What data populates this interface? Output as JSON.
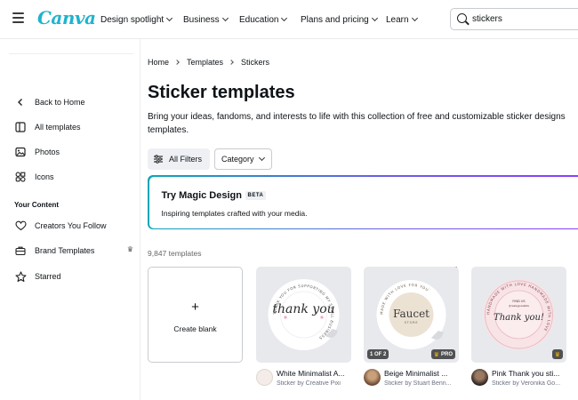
{
  "app": {
    "logo": "Canva"
  },
  "nav": {
    "items": [
      {
        "label": "Design spotlight"
      },
      {
        "label": "Business"
      },
      {
        "label": "Education"
      },
      {
        "label": "Plans and pricing"
      },
      {
        "label": "Learn"
      }
    ]
  },
  "search": {
    "value": "stickers",
    "placeholder": "Search"
  },
  "sidebar": {
    "back": "Back to Home",
    "items": [
      {
        "label": "All templates"
      },
      {
        "label": "Photos"
      },
      {
        "label": "Icons"
      }
    ],
    "section_title": "Your Content",
    "content_items": [
      {
        "label": "Creators You Follow"
      },
      {
        "label": "Brand Templates"
      },
      {
        "label": "Starred"
      }
    ]
  },
  "breadcrumb": [
    "Home",
    "Templates",
    "Stickers"
  ],
  "page": {
    "title": "Sticker templates",
    "description": "Bring your ideas, fandoms, and interests to life with this collection of free and customizable sticker designs templates."
  },
  "filters": {
    "all_filters": "All Filters",
    "category": "Category"
  },
  "magic": {
    "title": "Try Magic Design",
    "badge": "BETA",
    "subtitle": "Inspiring templates crafted with your media."
  },
  "results": {
    "count": "9,847 templates",
    "create_blank": "Create blank"
  },
  "templates": [
    {
      "sticker_text": "thank you",
      "ring_text": "THANK YOU FOR SUPPORTING MY SMALL BUSINESS",
      "title": "White Minimalist A...",
      "subtitle": "Sticker by Creative Pixi"
    },
    {
      "sticker_text": "Faucet",
      "sticker_sub": "STORE",
      "ring_text": "MADE WITH LOVE FOR YOU",
      "page_badge": "1 OF 2",
      "pro_badge": "PRO",
      "title": "Beige Minimalist ...",
      "subtitle": "Sticker by Stuart Benn..."
    },
    {
      "sticker_text": "Thank you!",
      "sticker_top": "FIND US",
      "sticker_handle": "@reallygreatsite",
      "ring_text": "HANDMADE WITH LOVE HANDMADE WITH LOVE",
      "title": "Pink Thank you sti...",
      "subtitle": "Sticker by Veronika Go..."
    }
  ],
  "colors": {
    "brand": "#1fb3cf",
    "pro_crown": "#f2b705",
    "magic_gradient_start": "#0ba6b8",
    "magic_gradient_end": "#8b3dff"
  }
}
